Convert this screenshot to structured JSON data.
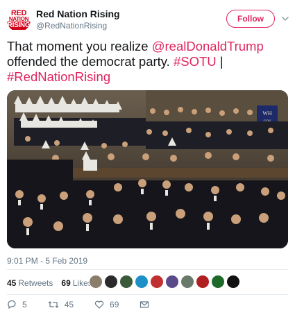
{
  "profile": {
    "logo_text": [
      "RED",
      "NATION",
      "RISING"
    ],
    "display_name": "Red Nation Rising",
    "handle": "@RedNationRising"
  },
  "follow_label": "Follow",
  "tweet": {
    "text_plain_1": "That moment you realize ",
    "mention": "@realDonaldTrump",
    "text_plain_2": " offended the democrat party. ",
    "hashtag_1": "#SOTU",
    "separator": " | ",
    "hashtag_2": "#RedNationRising"
  },
  "media": {
    "sign_text": "WH",
    "sign_subtext": "GOV"
  },
  "timestamp": "9:01 PM - 5 Feb 2019",
  "stats": {
    "retweets_count": "45",
    "retweets_label": "Retweets",
    "likes_count": "69",
    "likes_label": "Likes"
  },
  "likers": [
    "#8a7d6b",
    "#2b2b2b",
    "#3a5a3a",
    "#1e90c8",
    "#c03030",
    "#5a4a8a",
    "#6a7a6a",
    "#b02020",
    "#1f6a2a",
    "#111111"
  ],
  "actions": {
    "reply_count": "5",
    "retweet_count": "45",
    "like_count": "69"
  },
  "colors": {
    "accent": "#e0245e",
    "brand_red": "#d0021b",
    "muted": "#657786"
  }
}
